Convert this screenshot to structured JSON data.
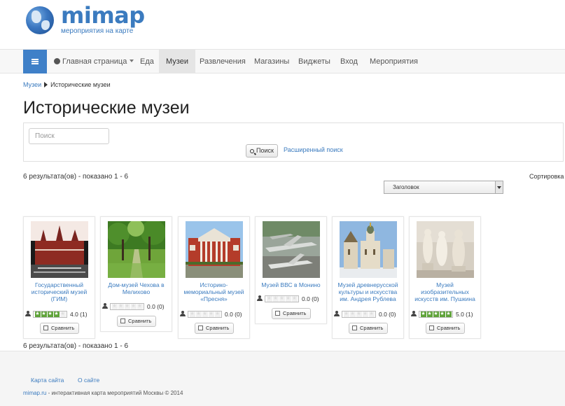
{
  "site": {
    "name": "mimap",
    "tagline": "мероприятия на карте"
  },
  "nav": {
    "items": [
      {
        "label": "Главная страница",
        "has_dropdown": true,
        "icon": "globe-icon"
      },
      {
        "label": "Еда"
      },
      {
        "label": "Музеи",
        "active": true
      },
      {
        "label": "Развлечения"
      },
      {
        "label": "Магазины"
      },
      {
        "label": "Виджеты"
      },
      {
        "label": "Вход"
      },
      {
        "label": "Мероприятия"
      }
    ]
  },
  "breadcrumb": {
    "parent": "Музеи",
    "current": "Исторические музеи"
  },
  "page_title": "Исторические музеи",
  "search": {
    "placeholder": "Поиск",
    "button_label": "Поиск",
    "advanced_label": "Расширенный поиск"
  },
  "results": {
    "summary": "6 результата(ов) - показано 1 - 6",
    "sort_label": "Сортировка",
    "sort_selected": "Заголовок"
  },
  "compare_label": "Сравнить",
  "cards": [
    {
      "title": "Государственный исторический музей (ГИМ)",
      "stars": 4,
      "rating_text": "4.0 (1)",
      "image": "red-square-museum"
    },
    {
      "title": "Дом-музей Чехова в Мелихово",
      "stars": 0,
      "rating_text": "0.0 (0)",
      "image": "park-alley"
    },
    {
      "title": "Историко-мемориальный музей «Пресня»",
      "stars": 0,
      "rating_text": "0.0 (0)",
      "image": "classic-building"
    },
    {
      "title": "Музей ВВС в Монино",
      "stars": 0,
      "rating_text": "0.0 (0)",
      "image": "aircraft"
    },
    {
      "title": "Музей древнерусской культуры и искусства им. Андрея Рублева",
      "stars": 0,
      "rating_text": "0.0 (0)",
      "image": "monastery"
    },
    {
      "title": "Музей изобразительных искусств им. Пушкина",
      "stars": 5,
      "rating_text": "5.0 (1)",
      "image": "statues"
    }
  ],
  "footer": {
    "links": [
      "Карта сайта",
      "О сайте"
    ],
    "copyright_link": "mimap.ru",
    "copyright_text": " - интерактивная карта мероприятий Москвы © 2014"
  },
  "colors": {
    "brand": "#3b7bbf",
    "nav_toggle": "#3f80c8",
    "star_on": "#5fa33a"
  }
}
